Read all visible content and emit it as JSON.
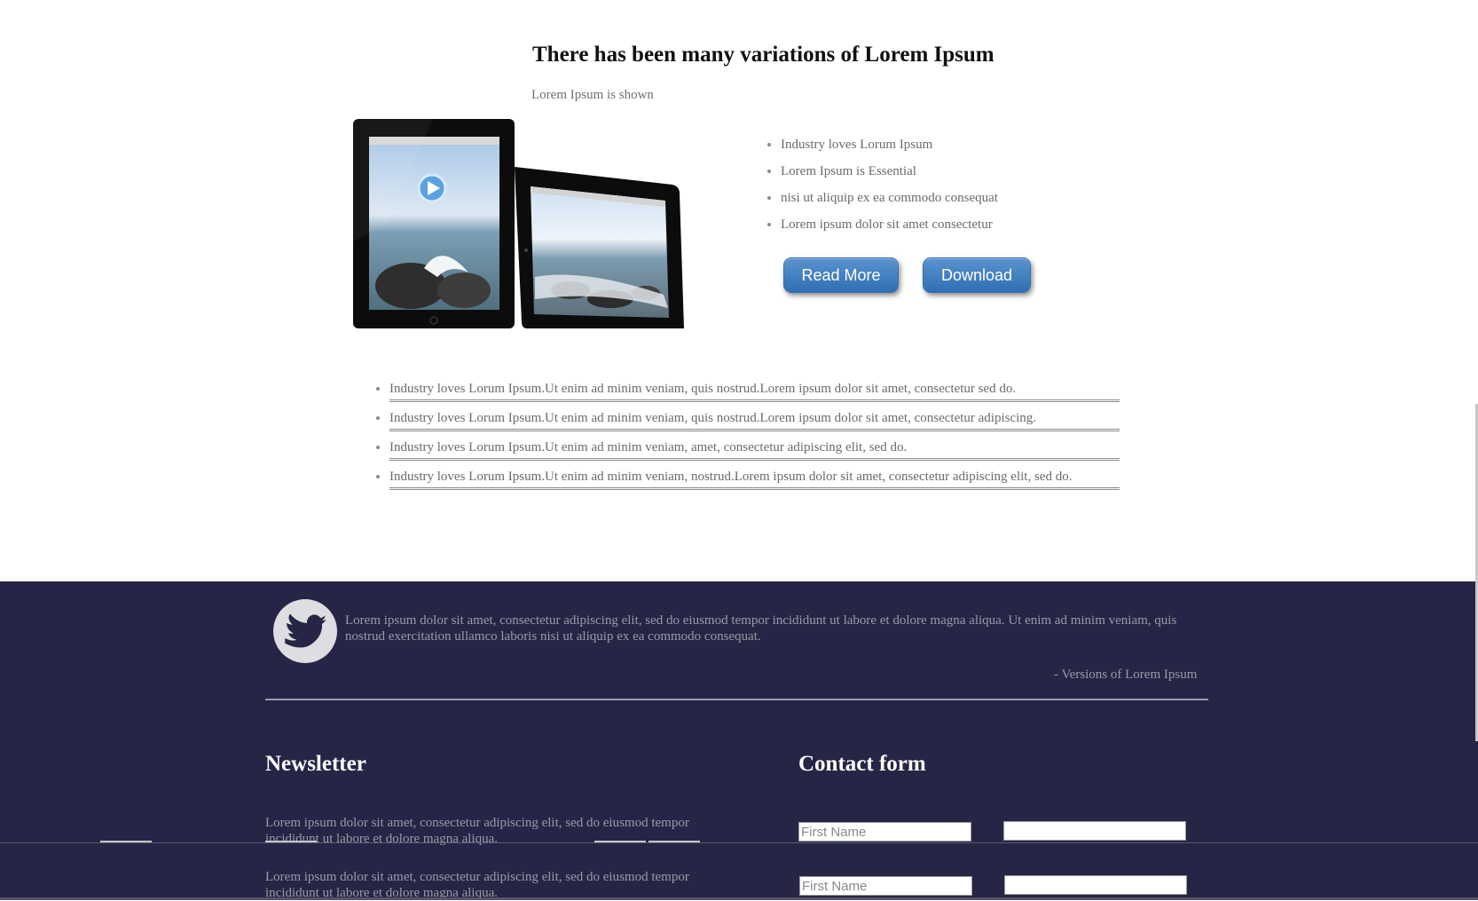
{
  "hero": {
    "title": "There has been many variations of Lorem Ipsum",
    "subtitle": "Lorem Ipsum is shown"
  },
  "features": {
    "items": [
      "Industry loves Lorum Ipsum",
      "Lorem Ipsum is Essential",
      "nisi ut aliquip ex ea commodo consequat",
      "Lorem ipsum dolor sit amet consectetur"
    ],
    "read_more_label": "Read More",
    "download_label": "Download"
  },
  "details": {
    "items": [
      "Industry loves Lorum Ipsum.Ut enim ad minim veniam, quis nostrud.Lorem ipsum dolor sit amet, consectetur sed do.",
      "Industry loves Lorum Ipsum.Ut enim ad minim veniam, quis nostrud.Lorem ipsum dolor sit amet, consectetur adipiscing.",
      "Industry loves Lorum Ipsum.Ut enim ad minim veniam, amet, consectetur adipiscing elit, sed do.",
      "Industry loves Lorum Ipsum.Ut enim ad minim veniam, nostrud.Lorem ipsum dolor sit amet, consectetur adipiscing elit, sed do."
    ]
  },
  "footer": {
    "quote": "Lorem ipsum dolor sit amet, consectetur adipiscing elit, sed do eiusmod tempor incididunt ut labore et dolore magna aliqua. Ut enim ad minim veniam, quis nostrud exercitation ullamco laboris nisi ut aliquip ex ea commodo consequat.",
    "quote_author": "- Versions of Lorem Ipsum",
    "newsletter_title": "Newsletter",
    "newsletter_text": "Lorem ipsum dolor sit amet, consectetur adipiscing elit, sed do eiusmod tempor incididunt ut labore et dolore magna aliqua.",
    "contact_title": "Contact form",
    "first_name_placeholder": "First Name",
    "icon": "twitter-bird-icon"
  },
  "colors": {
    "footer_bg": "#262545",
    "button_blue": "#3a78bd"
  }
}
